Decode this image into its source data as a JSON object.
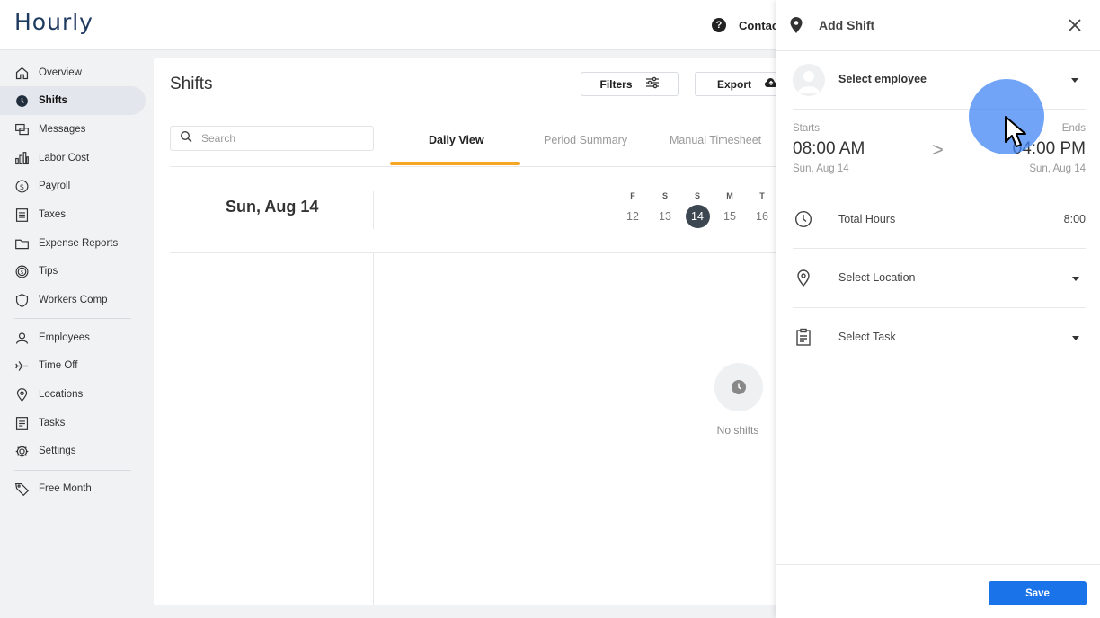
{
  "app": {
    "logo": "Hourly",
    "contact_label": "Contact",
    "help_glyph": "?"
  },
  "sidebar": {
    "items": [
      {
        "label": "Overview",
        "icon": "home-icon"
      },
      {
        "label": "Shifts",
        "icon": "clock-icon",
        "active": true
      },
      {
        "label": "Messages",
        "icon": "messages-icon"
      },
      {
        "label": "Labor Cost",
        "icon": "bar-chart-icon"
      },
      {
        "label": "Payroll",
        "icon": "dollar-icon"
      },
      {
        "label": "Taxes",
        "icon": "document-icon"
      },
      {
        "label": "Expense Reports",
        "icon": "folder-icon"
      },
      {
        "label": "Tips",
        "icon": "coin-icon"
      },
      {
        "label": "Workers Comp",
        "icon": "shield-icon"
      },
      {
        "label": "Employees",
        "icon": "person-icon"
      },
      {
        "label": "Time Off",
        "icon": "plane-icon"
      },
      {
        "label": "Locations",
        "icon": "location-pin-icon"
      },
      {
        "label": "Tasks",
        "icon": "list-icon"
      },
      {
        "label": "Settings",
        "icon": "gear-icon"
      },
      {
        "label": "Free Month",
        "icon": "tag-icon"
      }
    ]
  },
  "main": {
    "title": "Shifts",
    "filters_label": "Filters",
    "export_label": "Export",
    "search_placeholder": "Search",
    "tabs": [
      {
        "label": "Daily View",
        "active": true
      },
      {
        "label": "Period Summary"
      },
      {
        "label": "Manual Timesheet"
      }
    ],
    "date_heading": "Sun, Aug 14",
    "week": [
      {
        "dow": "F",
        "num": "12"
      },
      {
        "dow": "S",
        "num": "13"
      },
      {
        "dow": "S",
        "num": "14",
        "selected": true
      },
      {
        "dow": "M",
        "num": "15"
      },
      {
        "dow": "T",
        "num": "16"
      }
    ],
    "empty_text": "No shifts"
  },
  "panel": {
    "title": "Add Shift",
    "employee_label": "Select employee",
    "starts_label": "Starts",
    "ends_label": "Ends",
    "start_time": "08:00 AM",
    "end_time": "04:00 PM",
    "start_date": "Sun, Aug 14",
    "end_date": "Sun, Aug 14",
    "arrow": ">",
    "total_hours_label": "Total Hours",
    "total_hours_value": "8:00",
    "location_label": "Select Location",
    "task_label": "Select Task",
    "save_label": "Save"
  },
  "colors": {
    "accent": "#f5a623",
    "primary": "#1a73e8",
    "logo": "#1f3a5f"
  }
}
